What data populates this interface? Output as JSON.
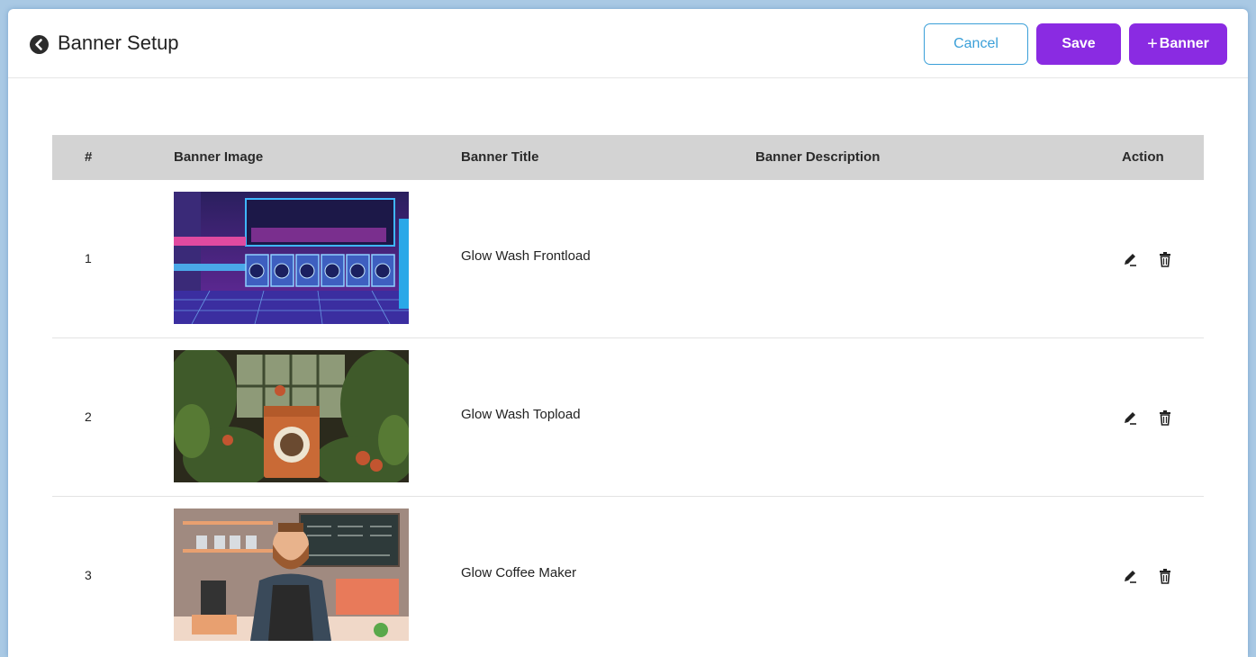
{
  "header": {
    "title": "Banner Setup",
    "cancel_label": "Cancel",
    "save_label": "Save",
    "add_banner_label": "Banner"
  },
  "table": {
    "columns": [
      "#",
      "Banner Image",
      "Banner Title",
      "Banner Description",
      "Action"
    ],
    "rows": [
      {
        "index": "1",
        "title": "Glow Wash Frontload",
        "description": "",
        "image": "laundromat-neon-banner"
      },
      {
        "index": "2",
        "title": "Glow Wash Topload",
        "description": "",
        "image": "jungle-washer-banner"
      },
      {
        "index": "3",
        "title": "Glow Coffee Maker",
        "description": "",
        "image": "barista-cafe-banner"
      }
    ]
  },
  "colors": {
    "primary": "#8a2be2",
    "cancel": "#3a9fd8",
    "table_header": "#d3d3d3"
  }
}
